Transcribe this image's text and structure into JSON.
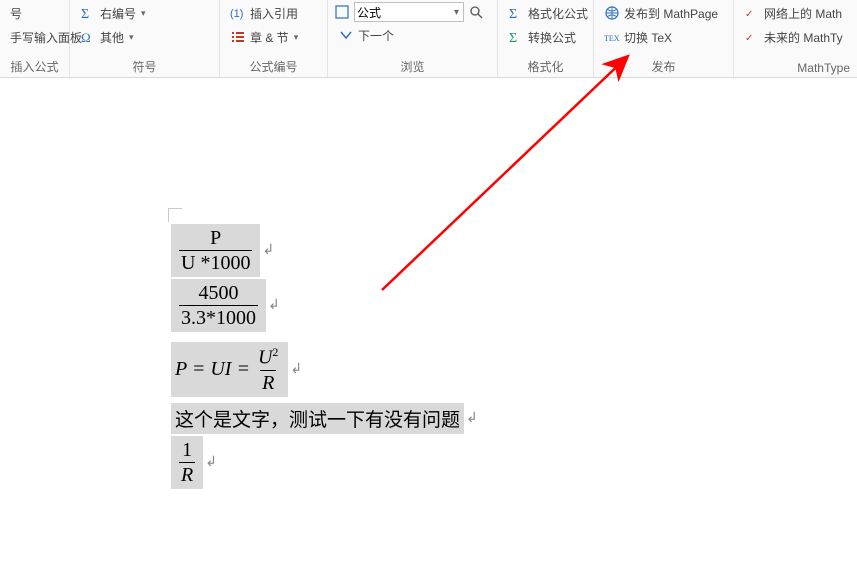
{
  "ribbon": {
    "group_insert": {
      "label": "插入公式",
      "items": {
        "number": {
          "label": "号"
        },
        "hand_input": {
          "label": "手写输入面板"
        }
      }
    },
    "group_symbol": {
      "label": "符号",
      "items": {
        "right_bracket": {
          "label": "右编号"
        },
        "other": {
          "label": "其他"
        }
      }
    },
    "group_eqnum": {
      "label": "公式编号",
      "items": {
        "insert_ref": {
          "label": "插入引用"
        },
        "chapter_sec": {
          "label": "章 & 节"
        }
      }
    },
    "group_browse": {
      "label": "浏览",
      "items": {
        "combo_label": "公式",
        "next": {
          "label": "下一个"
        }
      }
    },
    "group_format": {
      "label": "格式化",
      "items": {
        "format_eq": {
          "label": "格式化公式"
        },
        "convert_eq": {
          "label": "转换公式"
        }
      }
    },
    "group_publish": {
      "label": "发布",
      "items": {
        "mathpage": {
          "label": "发布到 MathPage"
        },
        "tex": {
          "label": "切换 TeX"
        }
      }
    },
    "group_mathtype": {
      "label": "MathType",
      "items": {
        "web_math": {
          "label": "网络上的 Math"
        },
        "future_mt": {
          "label": "未来的 MathTy"
        }
      }
    }
  },
  "document": {
    "eq1": {
      "num": "P",
      "den": "U *1000"
    },
    "eq2": {
      "num": "4500",
      "den": "3.3*1000"
    },
    "eq3": {
      "prefix": "P = UI = ",
      "num": "U",
      "num_sup": "2",
      "den": "R"
    },
    "text_line": "这个是文字，测试一下有没有问题",
    "eq4": {
      "num": "1",
      "den": "R"
    }
  }
}
